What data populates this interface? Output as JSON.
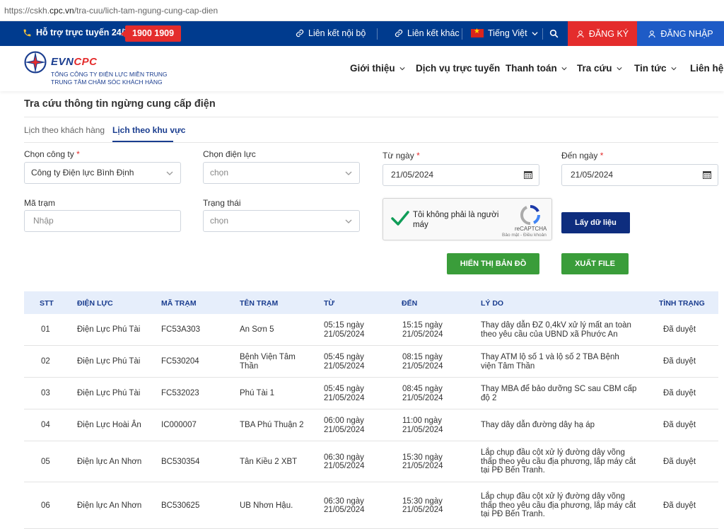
{
  "browser": {
    "url_prefix": "https://cskh.",
    "url_domain": "cpc.vn",
    "url_path": "/tra-cuu/lich-tam-ngung-cung-cap-dien"
  },
  "topbar": {
    "support_label": "Hỗ trợ trực tuyến 24/7:",
    "hotline": "1900 1909",
    "link_internal": "Liên kết nội bộ",
    "link_external": "Liên kết khác",
    "language": "Tiếng Việt",
    "register": "ĐĂNG KÝ",
    "login": "ĐĂNG NHẬP"
  },
  "header": {
    "logo_evn": "EVN",
    "logo_cpc": "CPC",
    "logo_sub1": "TỔNG CÔNG TY ĐIỆN LỰC MIỀN TRUNG",
    "logo_sub2": "TRUNG TÂM CHĂM SÓC KHÁCH HÀNG",
    "nav": [
      "Giới thiệu",
      "Dịch vụ trực tuyến",
      "Thanh toán",
      "Tra cứu",
      "Tin tức",
      "Liên hệ"
    ]
  },
  "page": {
    "title": "Tra cứu thông tin ngừng cung cấp điện",
    "tabs": [
      "Lịch theo khách hàng",
      "Lịch theo khu vực"
    ]
  },
  "form": {
    "company_label": "Chọn công ty",
    "company_value": "Công ty Điện lực Bình Định",
    "power_label": "Chọn điện lực",
    "power_placeholder": "chọn",
    "from_label": "Từ ngày",
    "from_value": "21/05/2024",
    "to_label": "Đến ngày",
    "to_value": "21/05/2024",
    "station_label": "Mã trạm",
    "station_placeholder": "Nhập",
    "status_label": "Trạng thái",
    "status_placeholder": "chọn",
    "captcha_text": "Tôi không phải là người máy",
    "captcha_brand": "reCAPTCHA",
    "captcha_terms": "Bảo mật - Điều khoản",
    "fetch_button": "Lấy dữ liệu",
    "map_button": "HIỂN THỊ BẢN ĐỒ",
    "export_button": "XUẤT FILE"
  },
  "table": {
    "headers": [
      "STT",
      "ĐIỆN LỰC",
      "MÃ TRẠM",
      "TÊN TRẠM",
      "TỪ",
      "ĐẾN",
      "LÝ DO",
      "TÌNH TRẠNG"
    ],
    "rows": [
      {
        "stt": "01",
        "dl": "Điện Lực Phú Tài",
        "code": "FC53A303",
        "name1": "An Sơn 5",
        "name2": "",
        "from1": "05:15 ngày",
        "from2": "21/05/2024",
        "to1": "15:15 ngày",
        "to2": "21/05/2024",
        "r1": "Thay dây dẫn ĐZ 0,4kV xử lý mất an toàn",
        "r2": "theo yêu cầu của UBND xã Phước An",
        "r3": "",
        "status": "Đã duyệt"
      },
      {
        "stt": "02",
        "dl": "Điện Lực Phú Tài",
        "code": "FC530204",
        "name1": "Bệnh Viện Tâm",
        "name2": "Thần",
        "from1": "05:45 ngày",
        "from2": "21/05/2024",
        "to1": "08:15 ngày",
        "to2": "21/05/2024",
        "r1": "Thay ATM lộ số 1 và lộ số 2 TBA Bệnh",
        "r2": "viện Tâm Thần",
        "r3": "",
        "status": "Đã duyệt"
      },
      {
        "stt": "03",
        "dl": "Điện Lực Phú Tài",
        "code": "FC532023",
        "name1": "Phú Tài 1",
        "name2": "",
        "from1": "05:45 ngày",
        "from2": "21/05/2024",
        "to1": "08:45 ngày",
        "to2": "21/05/2024",
        "r1": "Thay MBA để bảo dưỡng SC sau CBM cấp",
        "r2": "độ 2",
        "r3": "",
        "status": "Đã duyệt"
      },
      {
        "stt": "04",
        "dl": "Điện Lực Hoài Ân",
        "code": "IC000007",
        "name1": "TBA Phú Thuận 2",
        "name2": "",
        "from1": "06:00 ngày",
        "from2": "21/05/2024",
        "to1": "11:00 ngày",
        "to2": "21/05/2024",
        "r1": "Thay dây dẫn đường dây hạ áp",
        "r2": "",
        "r3": "",
        "status": "Đã duyệt"
      },
      {
        "stt": "05",
        "dl": "Điện lực An Nhơn",
        "code": "BC530354",
        "name1": "Tân Kiều 2 XBT",
        "name2": "",
        "from1": "06:30 ngày",
        "from2": "21/05/2024",
        "to1": "15:30 ngày",
        "to2": "21/05/2024",
        "r1": "Lắp chụp đầu cột xử lý đường dây võng",
        "r2": "thấp theo yêu cầu địa phương, lắp máy cắt",
        "r3": "tại PĐ Bến Tranh.",
        "status": "Đã duyệt"
      },
      {
        "stt": "06",
        "dl": "Điện lực An Nhơn",
        "code": "BC530625",
        "name1": "UB Nhơn Hậu.",
        "name2": "",
        "from1": "06:30 ngày",
        "from2": "21/05/2024",
        "to1": "15:30 ngày",
        "to2": "21/05/2024",
        "r1": "Lắp chụp đầu cột xử lý đường dây võng",
        "r2": "thấp theo yêu cầu địa phương, lắp máy cắt",
        "r3": "tại PĐ Bến Tranh.",
        "status": "Đã duyệt"
      }
    ]
  }
}
